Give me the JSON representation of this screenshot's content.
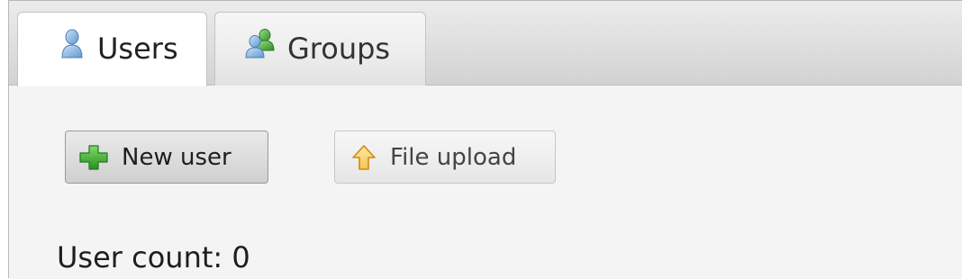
{
  "tabs": [
    {
      "label": "Users",
      "icon": "user-icon",
      "active": true
    },
    {
      "label": "Groups",
      "icon": "group-icon",
      "active": false
    }
  ],
  "toolbar": {
    "new_user_label": "New user",
    "new_user_icon": "plus-icon",
    "file_upload_label": "File upload",
    "file_upload_icon": "upload-arrow-icon"
  },
  "status": {
    "user_count_label": "User count:",
    "user_count_value": "0",
    "user_count_text": "User count: 0"
  },
  "colors": {
    "plus_green": "#3aa42c",
    "upload_orange": "#e8a020",
    "user_blue": "#7fb0e0",
    "group_green": "#3cab33"
  }
}
